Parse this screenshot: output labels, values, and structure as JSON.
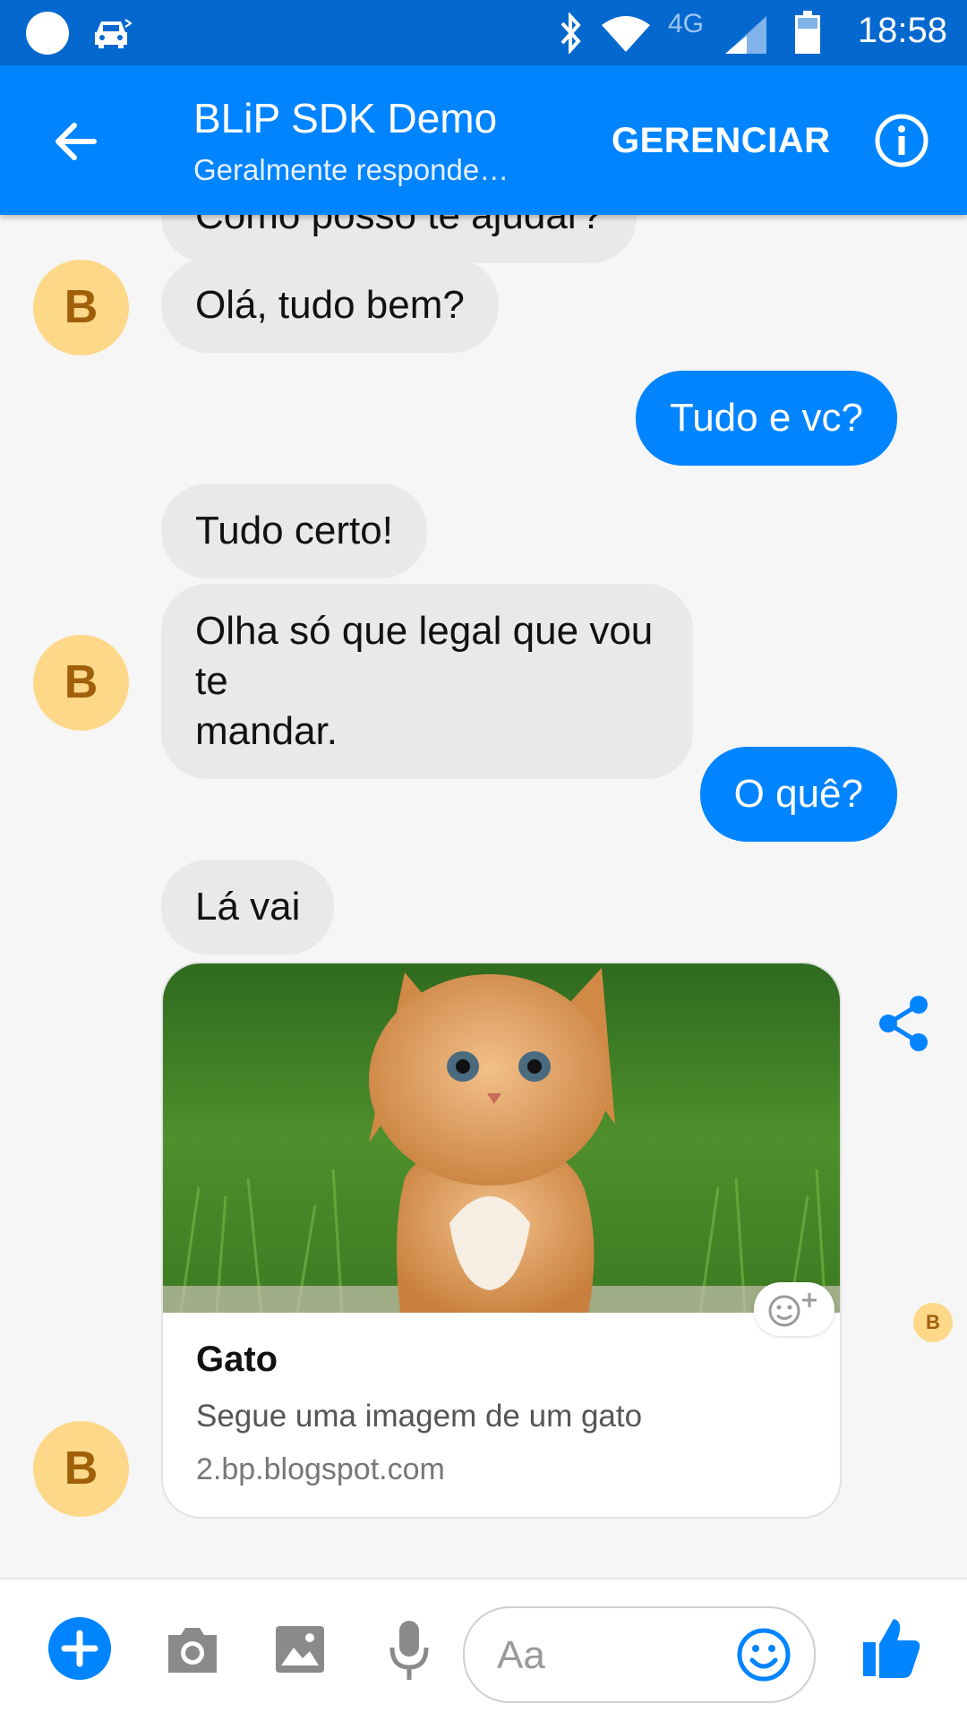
{
  "status_bar": {
    "network_label": "4G",
    "time": "18:58"
  },
  "header": {
    "title": "BLiP SDK Demo",
    "subtitle": "Geralmente responde…",
    "manage_label": "GERENCIAR",
    "back_icon": "arrow-left-icon",
    "info_icon": "info-icon"
  },
  "messages": {
    "partial_top": "Como posso te ajudar?",
    "m1": "Olá, tudo bem?",
    "m2": "Tudo e vc?",
    "m3": "Tudo certo!",
    "m4_line1": "Olha só que legal que vou te",
    "m4_line2": "mandar.",
    "m5": "O quê?",
    "m6": "Lá vai"
  },
  "avatar_letter": "B",
  "card": {
    "title": "Gato",
    "description": "Segue uma imagem de um gato",
    "url": "2.bp.blogspot.com"
  },
  "composer": {
    "placeholder": "Aa"
  },
  "colors": {
    "brand": "#0084ff",
    "status_bar": "#0468cf",
    "avatar_bg": "#fdd888"
  }
}
